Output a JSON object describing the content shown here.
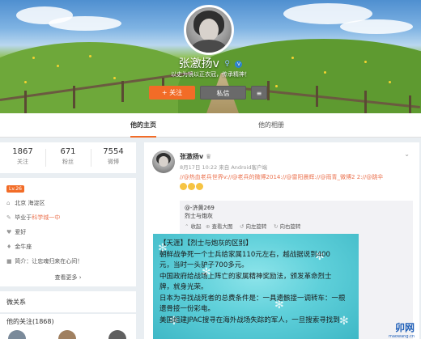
{
  "profile": {
    "name": "张激扬v",
    "gender_icon": "♀",
    "verified_icon": "v-badge-icon",
    "intro": "以史为镜以正衣冠，传承精神！",
    "follow_label": "+ 关注",
    "message_label": "私信",
    "more_icon": "menu-icon"
  },
  "tabs": [
    {
      "label": "他的主页"
    },
    {
      "label": "他的相册"
    }
  ],
  "stats": [
    {
      "num": "1867",
      "label": "关注"
    },
    {
      "num": "671",
      "label": "粉丝"
    },
    {
      "num": "7554",
      "label": "微博"
    }
  ],
  "info": {
    "level": "Lv.26",
    "location": "北京 海淀区",
    "school_prefix": "毕业于",
    "school": "科学城一中",
    "tag1": "爱好",
    "tag2": "金牛座",
    "intro_prefix": "简介：",
    "intro": "让忠魂归来在心间！",
    "more": "查看更多 ›"
  },
  "modules": {
    "title": "微关系",
    "following": "他的关注(1868)"
  },
  "post": {
    "name": "张激扬v",
    "meta": "8月17日 10:22 来自 Android客户端",
    "text": "//@热血老兵世界v://@老兵的微博2014://@雷阳晨辉://@雨青_微博2 2://@跳伞",
    "repost_user": "@-济黄269",
    "repost_sub": "烈士与炮灰",
    "actions": {
      "collapse": "收起",
      "big": "查看大图",
      "left": "向左旋转",
      "right": "向右旋转"
    },
    "image_text": [
      "【天涯】【烈士与炮灰的区别】",
      "朝鲜战争死一个士兵给家属110元左右，越战据说到400",
      "元，当时一头驴子700多元。",
      "中国政府给战场上阵亡的家属精神奖励法，颁发革命烈士",
      "牌，就身光荣。",
      "日本为寻找战死者的总费条件是：一具遗骸接一调转车：一根",
      "遗骨接一份彩电。",
      "美国组建JPAC搜寻在海外战场失踪的军人，一旦搜索寻找到"
    ]
  },
  "watermark": {
    "text": "卯网",
    "sub": "maowang.cn"
  }
}
